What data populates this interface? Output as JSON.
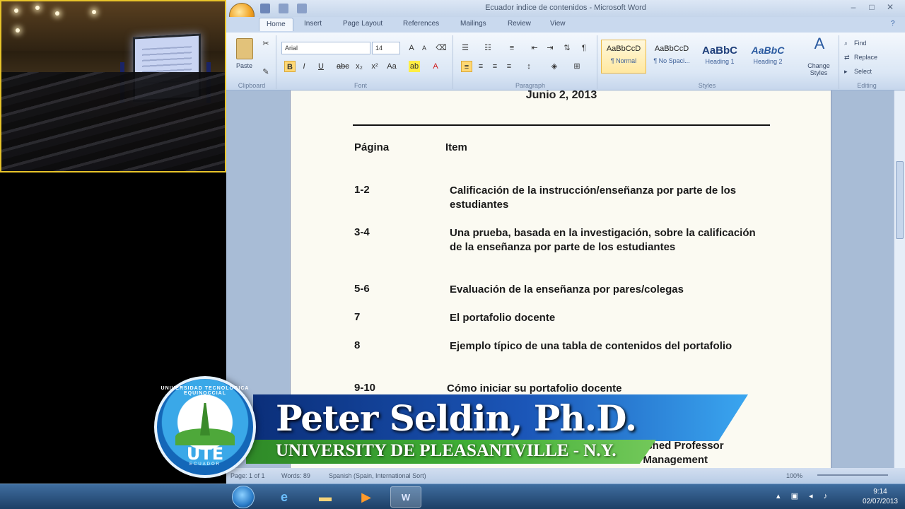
{
  "window": {
    "title": "Ecuador indice de contenidos - Microsoft Word"
  },
  "ribbon": {
    "tabs": [
      "Home",
      "Insert",
      "Page Layout",
      "References",
      "Mailings",
      "Review",
      "View"
    ],
    "clipboard": {
      "paste_label": "Paste",
      "group_label": "Clipboard"
    },
    "font": {
      "name": "Arial",
      "size": "14",
      "group_label": "Font"
    },
    "paragraph": {
      "group_label": "Paragraph"
    },
    "styles": {
      "group_label": "Styles",
      "items": [
        {
          "sample": "AaBbCcD",
          "name": "¶ Normal"
        },
        {
          "sample": "AaBbCcD",
          "name": "¶ No Spaci..."
        },
        {
          "sample": "AaBbC",
          "name": "Heading 1"
        },
        {
          "sample": "AaBbC",
          "name": "Heading 2"
        }
      ],
      "change_styles": "Change Styles"
    },
    "editing": {
      "group_label": "Editing",
      "find": "Find",
      "replace": "Replace",
      "select": "Select"
    }
  },
  "document": {
    "date": "Junio 2, 2013",
    "header_page": "Página",
    "header_item": "Item",
    "rows": [
      {
        "page": "1-2",
        "item": "Calificación de la instrucción/enseñanza por parte de los estudiantes"
      },
      {
        "page": "3-4",
        "item": "Una prueba, basada en la investigación, sobre la calificación de la enseñanza por parte de los estudiantes"
      },
      {
        "page": "5-6",
        "item": "Evaluación de la enseñanza por pares/colegas"
      },
      {
        "page": "7",
        "item": "El portafolio docente"
      },
      {
        "page": "8",
        "item": "Ejemplo típico de una tabla de contenidos del portafolio"
      },
      {
        "page": "9-10",
        "item": "Cómo iniciar su portafolio docente"
      }
    ],
    "partial_line_1": "uished Professor",
    "partial_line_2": "/ Management"
  },
  "status": {
    "page": "Page: 1 of 1",
    "words": "Words: 89",
    "language": "Spanish (Spain, International Sort)",
    "zoom": "100%"
  },
  "taskbar": {
    "time": "9:14",
    "date": "02/07/2013"
  },
  "lower_third": {
    "name": "Peter Seldin, Ph.D.",
    "affiliation": "UNIVERSITY DE PLEASANTVILLE - N.Y.",
    "logo_abbr": "UTE",
    "logo_ring": "UNIVERSIDAD TECNOLÓGICA EQUINOCCIAL",
    "logo_country": "ECUADOR"
  }
}
